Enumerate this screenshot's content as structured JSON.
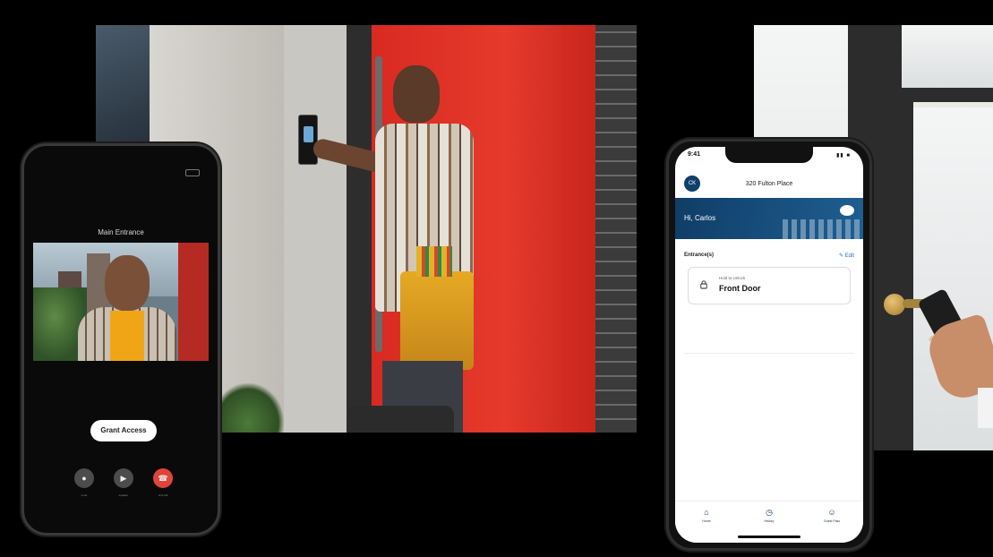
{
  "left_phone": {
    "title": "Main Entrance",
    "grant_button": "Grant Access",
    "controls": [
      {
        "icon": "microphone-icon",
        "label": "mute"
      },
      {
        "icon": "speaker-icon",
        "label": "speaker"
      },
      {
        "icon": "end-call-icon",
        "label": "end call"
      }
    ]
  },
  "right_phone": {
    "status_time": "9:41",
    "avatar_initials": "CK",
    "place_name": "320 Fulton Place",
    "greeting": "Hi, Carlos",
    "entrances_label": "Entrance(s)",
    "edit_label": "Edit",
    "card": {
      "hint": "Hold to Unlock",
      "door_name": "Front Door"
    },
    "tabs": [
      {
        "icon": "home-icon",
        "label": "Home"
      },
      {
        "icon": "history-icon",
        "label": "History"
      },
      {
        "icon": "guest-icon",
        "label": "Guest Pass"
      }
    ]
  },
  "colors": {
    "brand_navy": "#0f3d66",
    "end_call_red": "#e0443a",
    "door_red": "#d92a21",
    "link_blue": "#1e6fd0"
  }
}
